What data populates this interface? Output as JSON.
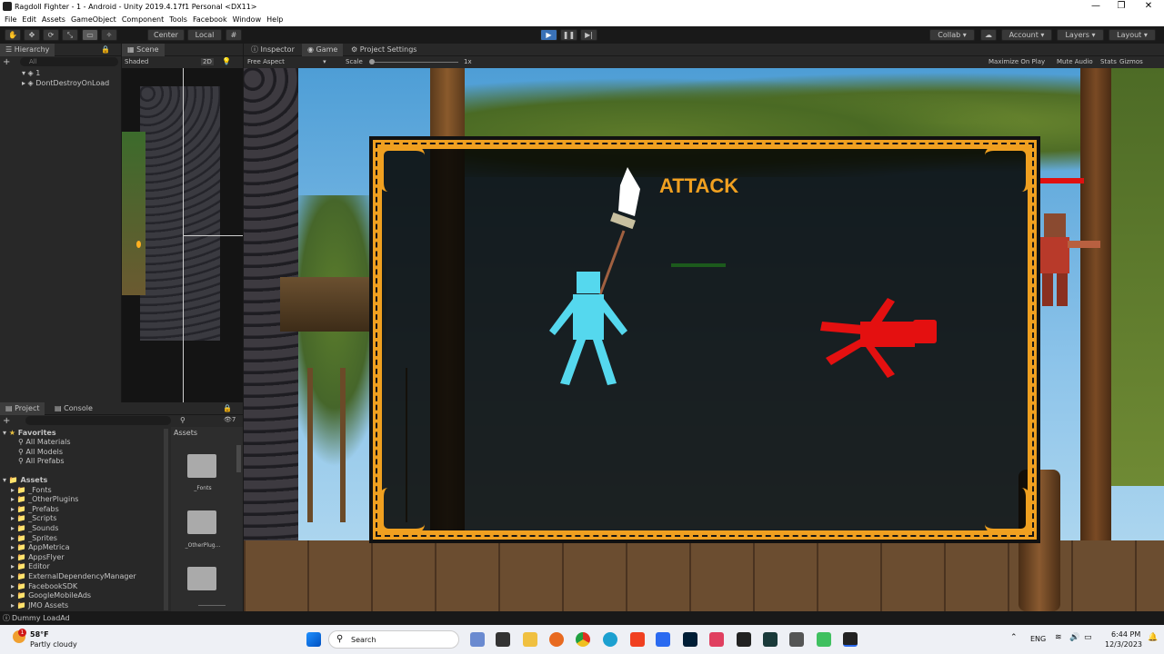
{
  "window": {
    "title": "Ragdoll Fighter - 1 - Android - Unity 2019.4.17f1 Personal <DX11>",
    "controls": [
      "—",
      "❐",
      "✕"
    ]
  },
  "menu": [
    "File",
    "Edit",
    "Assets",
    "GameObject",
    "Component",
    "Tools",
    "Facebook",
    "Window",
    "Help"
  ],
  "toolbar": {
    "center_label": "Center",
    "local_label": "Local",
    "collab_label": "Collab ▾",
    "account_label": "Account",
    "layers_label": "Layers",
    "layout_label": "Layout"
  },
  "hierarchy": {
    "tab": "Hierarchy",
    "search_placeholder": "All",
    "items": [
      "1",
      "DontDestroyOnLoad"
    ]
  },
  "scene": {
    "tab": "Scene",
    "shading": "Shaded",
    "mode_2d": "2D"
  },
  "game": {
    "tabs": [
      "Inspector",
      "Game",
      "Project Settings"
    ],
    "aspect": "Free Aspect",
    "scale_label": "Scale",
    "scale_value": "1x",
    "options": [
      "Maximize On Play",
      "Mute Audio",
      "Stats",
      "Gizmos"
    ],
    "overlay_title": "ATTACK"
  },
  "project": {
    "tabs": [
      "Project",
      "Console"
    ],
    "favorites_label": "Favorites",
    "favorites": [
      "All Materials",
      "All Models",
      "All Prefabs"
    ],
    "assets_label": "Assets",
    "assets_tree": [
      "_Fonts",
      "_OtherPlugins",
      "_Prefabs",
      "_Scripts",
      "_Sounds",
      "_Sprites",
      "AppMetrica",
      "AppsFlyer",
      "Editor",
      "ExternalDependencyManager",
      "FacebookSDK",
      "GoogleMobileAds",
      "JMO Assets"
    ],
    "assets_header": "Assets",
    "folders": [
      "_Fonts",
      "_OtherPlug..."
    ],
    "hidden_count": "7"
  },
  "status": {
    "message": "Dummy LoadAd"
  },
  "taskbar": {
    "weather_temp": "58°F",
    "weather_desc": "Partly cloudy",
    "search_label": "Search",
    "lang": "ENG",
    "time": "6:44 PM",
    "date": "12/3/2023",
    "notif_count": "1"
  },
  "colors": {
    "accent_orange": "#f0a020",
    "player_cyan": "#55d8ee",
    "enemy_red": "#e41010",
    "play_blue": "#3a72b8"
  }
}
